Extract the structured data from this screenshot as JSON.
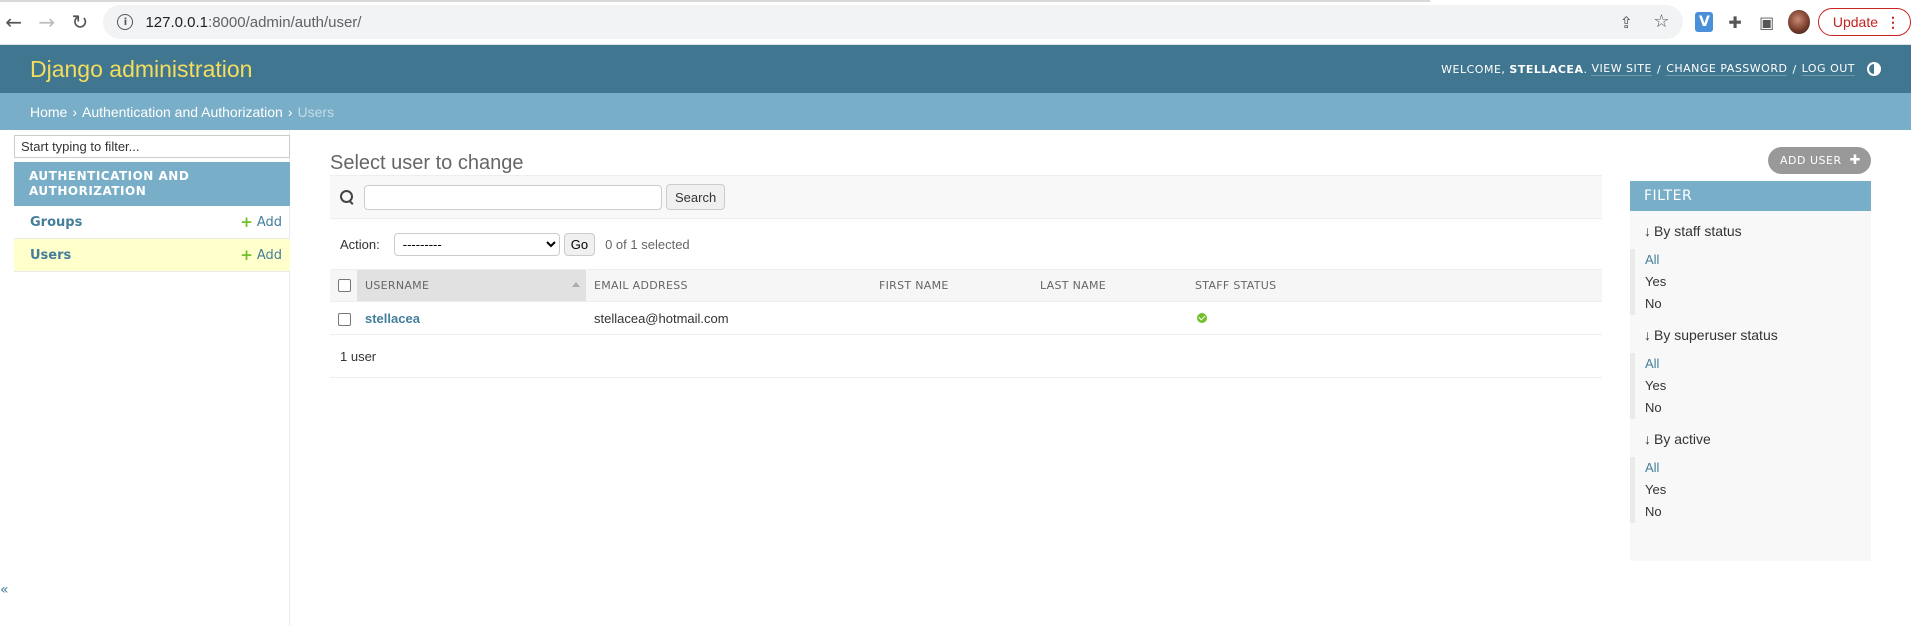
{
  "browser": {
    "url_host": "127.0.0.1",
    "url_path": ":8000/admin/auth/user/",
    "update_label": "Update"
  },
  "header": {
    "branding": "Django administration",
    "welcome": "WELCOME,",
    "username": "STELLACEA",
    "view_site": "VIEW SITE",
    "change_password": "CHANGE PASSWORD",
    "log_out": "LOG OUT"
  },
  "breadcrumbs": {
    "home": "Home",
    "app": "Authentication and Authorization",
    "current": "Users"
  },
  "sidebar": {
    "filter_placeholder": "Start typing to filter...",
    "app_caption": "AUTHENTICATION AND AUTHORIZATION",
    "models": [
      {
        "label": "Groups",
        "add": "Add"
      },
      {
        "label": "Users",
        "add": "Add"
      }
    ],
    "collapse": "«"
  },
  "main": {
    "title": "Select user to change",
    "add_user": "ADD USER",
    "search_button": "Search",
    "action_label": "Action:",
    "action_selected": "---------",
    "go_button": "Go",
    "counter": "0 of 1 selected",
    "columns": [
      "USERNAME",
      "EMAIL ADDRESS",
      "FIRST NAME",
      "LAST NAME",
      "STAFF STATUS"
    ],
    "rows": [
      {
        "username": "stellacea",
        "email": "stellacea@hotmail.com",
        "first_name": "",
        "last_name": "",
        "staff_status": true
      }
    ],
    "paginator": "1 user"
  },
  "filter": {
    "title": "FILTER",
    "groups": [
      {
        "title": "By staff status",
        "options": [
          "All",
          "Yes",
          "No"
        ],
        "selected": 0
      },
      {
        "title": "By superuser status",
        "options": [
          "All",
          "Yes",
          "No"
        ],
        "selected": 0
      },
      {
        "title": "By active",
        "options": [
          "All",
          "Yes",
          "No"
        ],
        "selected": 0
      }
    ]
  },
  "colors": {
    "header_bg": "#417690",
    "breadcrumbs_bg": "#79aec8",
    "branding": "#f5dd5d",
    "link": "#447e9b",
    "current_row": "#ffffcc",
    "yes": "#70bf2b"
  }
}
